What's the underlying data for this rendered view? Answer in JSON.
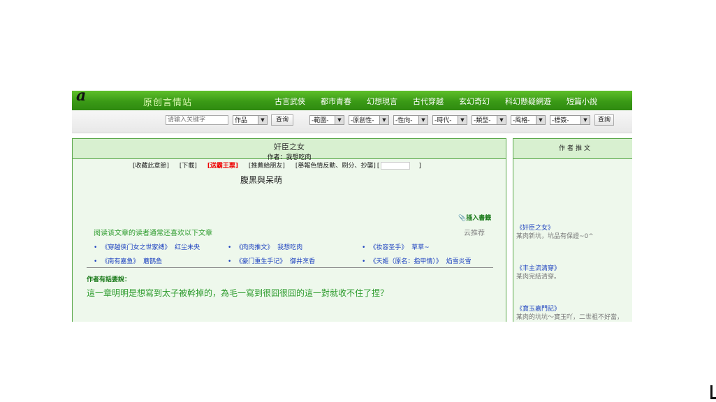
{
  "header": {
    "logo_text": "a",
    "site_name": "原创言情站",
    "nav": [
      "古言武俠",
      "都市青春",
      "幻想現言",
      "古代穿越",
      "玄幻奇幻",
      "科幻懸疑網遊",
      "短篇小說"
    ]
  },
  "search": {
    "placeholder": "请输入关键字",
    "type_select": "作品",
    "search_label": "查询",
    "filters": [
      "-範圍-",
      "-原創性-",
      "-性向-",
      "-時代-",
      "-類型-",
      "-風格-",
      "-標簽-"
    ],
    "filter_search_label": "查詢"
  },
  "chapter": {
    "title": "奸臣之女",
    "author_line": "作者：我想吃肉",
    "toolbar": {
      "collect": "[收藏此章節]",
      "download": "[下載]",
      "bawang": "[送霸王票]",
      "recommend_friend": "[推薦給朋友]",
      "report": "[舉報色情反動、刷分、抄襲]",
      "bracket_open": "[",
      "bracket_close": "]"
    },
    "content_title": "腹黑與呆萌",
    "bookmark": "插入書籤",
    "cloud_recommend": "云推荐",
    "also_read": "阅读该文章的读者通常还喜欢以下文章",
    "recs": [
      {
        "title": "《穿越侠门女之世家缚》",
        "author": "红尘未央"
      },
      {
        "title": "《肉肉推文》",
        "author": "我想吃肉"
      },
      {
        "title": "《妆容圣手》",
        "author": "草草~"
      },
      {
        "title": "《南有嘉鱼》",
        "author": "蘑鹊鱼"
      },
      {
        "title": "《豪门重生手记》",
        "author": "御井烹香"
      },
      {
        "title": "《天姬（原名：指甲情）》",
        "author": "焰雪炎雪"
      }
    ],
    "note_label": "作者有話要說：",
    "note_text": "這一章明明是想寫到太子被幹掉的，為毛一寫到很囧很囧的這一對就收不住了捏？"
  },
  "side": {
    "header": "作者推文",
    "items": [
      {
        "title": "《奸臣之女》",
        "desc": "某肉新坑，坑品有保證~0^"
      },
      {
        "title": "《丰主流清穿》",
        "desc": "某肉完結清穿。"
      },
      {
        "title": "《寶玉嘉門記》",
        "desc": "某肉的坑坑～寶玉吖，二世祖不好當，"
      }
    ]
  },
  "icons": {
    "bookmark": "paperclip-icon",
    "select_arrow": "triangle-down-icon"
  }
}
